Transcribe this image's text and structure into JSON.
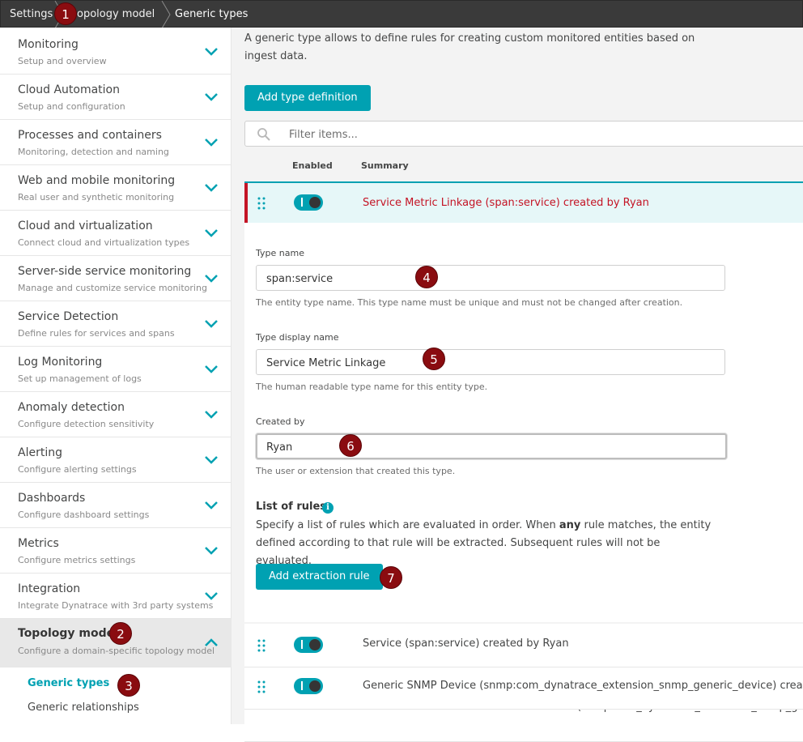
{
  "breadcrumb": {
    "settings": "Settings",
    "topology_model": "opology model",
    "generic_types": "Generic types"
  },
  "sidebar": {
    "items": [
      {
        "title": "Monitoring",
        "subtitle": "Setup and overview"
      },
      {
        "title": "Cloud Automation",
        "subtitle": "Setup and configuration"
      },
      {
        "title": "Processes and containers",
        "subtitle": "Monitoring, detection and naming"
      },
      {
        "title": "Web and mobile monitoring",
        "subtitle": "Real user and synthetic monitoring"
      },
      {
        "title": "Cloud and virtualization",
        "subtitle": "Connect cloud and virtualization types"
      },
      {
        "title": "Server-side service monitoring",
        "subtitle": "Manage and customize service monitoring"
      },
      {
        "title": "Service Detection",
        "subtitle": "Define rules for services and spans"
      },
      {
        "title": "Log Monitoring",
        "subtitle": "Set up management of logs"
      },
      {
        "title": "Anomaly detection",
        "subtitle": "Configure detection sensitivity"
      },
      {
        "title": "Alerting",
        "subtitle": "Configure alerting settings"
      },
      {
        "title": "Dashboards",
        "subtitle": "Configure dashboard settings"
      },
      {
        "title": "Metrics",
        "subtitle": "Configure metrics settings"
      },
      {
        "title": "Integration",
        "subtitle": "Integrate Dynatrace with 3rd party systems"
      }
    ],
    "active": {
      "title": "Topology model",
      "subtitle": "Configure a domain-specific topology model"
    },
    "sub_items": [
      "Generic types",
      "Generic relationships"
    ]
  },
  "main": {
    "intro": "A generic type allows to define rules for creating custom monitored entities based on ingest data.",
    "add_type_button": "Add type definition",
    "filter_placeholder": "Filter items...",
    "columns": {
      "enabled": "Enabled",
      "summary": "Summary"
    },
    "rows": [
      "Service Metric Linkage (span:service) created by Ryan",
      "Service (span:service) created by Ryan",
      "Generic SNMP Device (snmp:com_dynatrace_extension_snmp_generic_device) created by",
      "Generic SNMP Device Network Interface (snmp:com_dynatrace_extension_snmp_generic"
    ],
    "form": {
      "type_name_label": "Type name",
      "type_name_value": "span:service",
      "type_name_hint": "The entity type name. This type name must be unique and must not be changed after creation.",
      "display_name_label": "Type display name",
      "display_name_value": "Service Metric Linkage",
      "display_name_hint": "The human readable type name for this entity type.",
      "created_by_label": "Created by",
      "created_by_value": "Ryan",
      "created_by_hint": "The user or extension that created this type.",
      "rules_title": "List of rules",
      "rules_desc_1": "Specify a list of rules which are evaluated in order. When ",
      "rules_desc_bold": "any",
      "rules_desc_2": " rule matches, the entity defined according to that rule will be extracted. Subsequent rules will not be evaluated.",
      "add_rule_button": "Add extraction rule"
    }
  },
  "annotations": [
    "1",
    "2",
    "3",
    "4",
    "5",
    "6",
    "7"
  ],
  "colors": {
    "accent": "#00a1b2",
    "highlight_text": "#c41425",
    "badge": "#8a0c10",
    "topbar": "#3a3a3a"
  },
  "icons": [
    "chevron-down-icon",
    "chevron-up-icon",
    "search-icon",
    "drag-handle-icon",
    "info-icon",
    "toggle-switch"
  ]
}
